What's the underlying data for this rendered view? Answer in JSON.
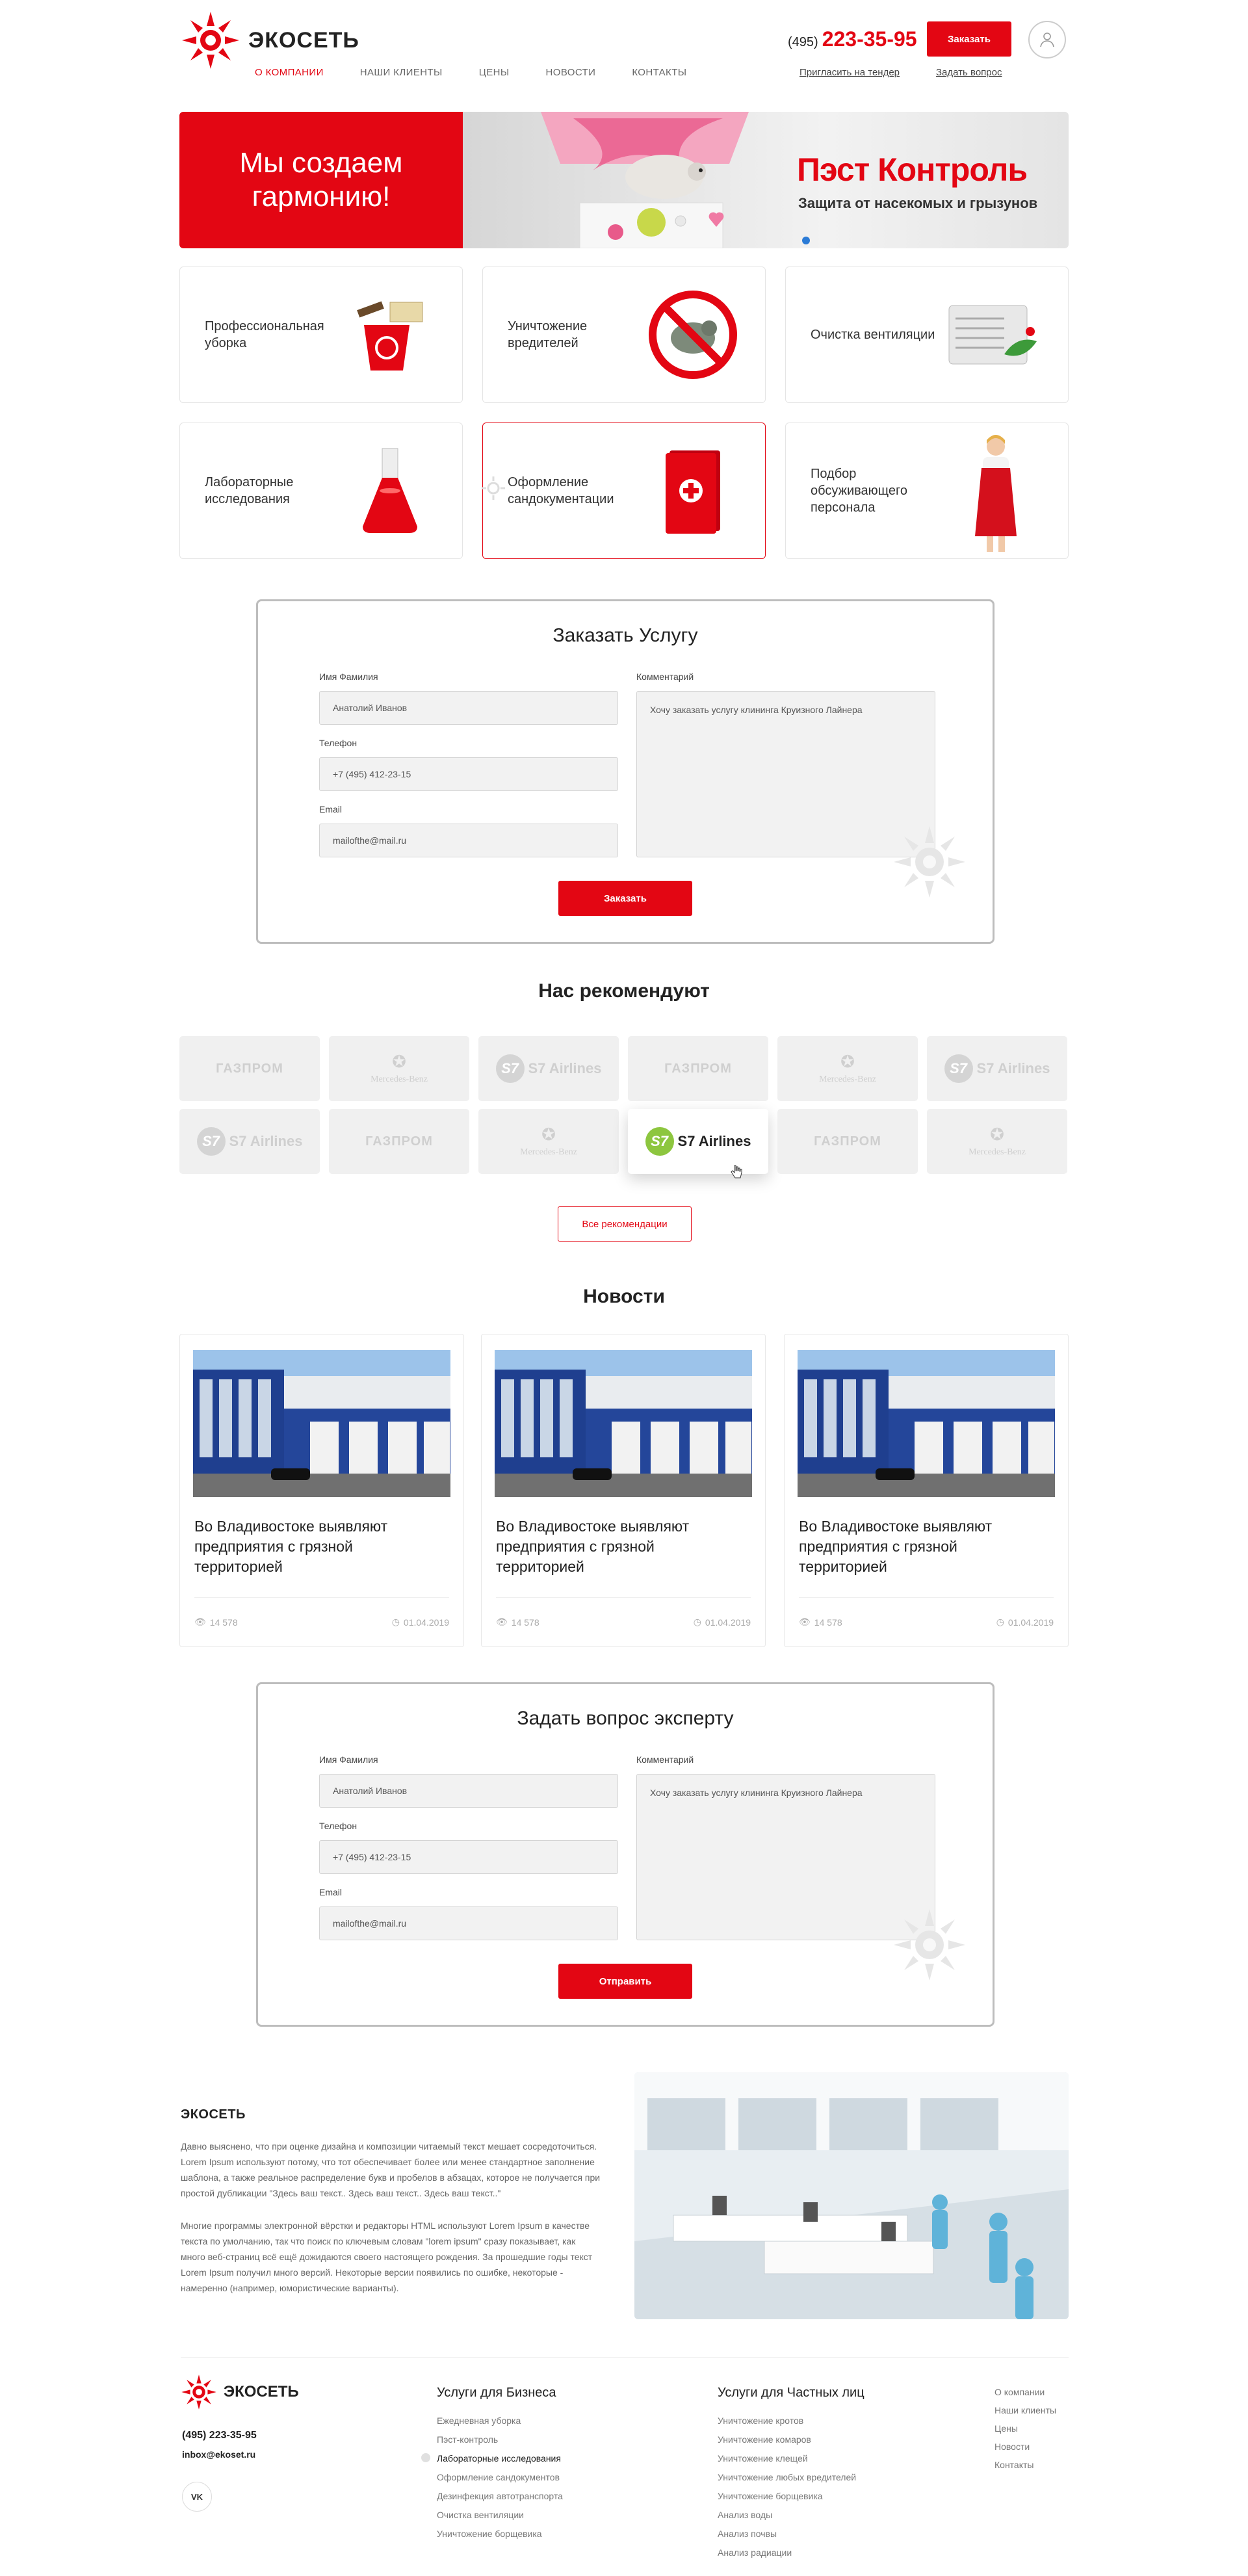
{
  "header": {
    "logo_text": "ЭКОСЕТЬ",
    "nav": [
      "О компании",
      "Наши клиенты",
      "Цены",
      "Новости",
      "Контакты"
    ],
    "phone_code": "(495)",
    "phone_number": "223-35-95",
    "order_button": "Заказать",
    "tender_link": "Пригласить на тендер",
    "question_link": "Задать вопрос"
  },
  "banner": {
    "left_text": "Мы создаем гармонию!",
    "title": "Пэст Контроль",
    "subtitle": "Защита от насекомых и грызунов"
  },
  "services": [
    {
      "label": "Профессиональная уборка",
      "icon": "cleaning-bucket-icon"
    },
    {
      "label": "Уничтожение вредителей",
      "icon": "no-rodent-icon"
    },
    {
      "label": "Очистка вентиляции",
      "icon": "air-conditioner-icon"
    },
    {
      "label": "Лабораторные исследования",
      "icon": "flask-icon"
    },
    {
      "label": "Оформление сандокументации",
      "icon": "red-book-icon"
    },
    {
      "label": "Подбор обсуживающего персонала",
      "icon": "staff-woman-icon"
    }
  ],
  "order_form": {
    "title": "Заказать Услугу",
    "name_label": "Имя Фамилия",
    "name_value": "Анатолий Иванов",
    "phone_label": "Телефон",
    "phone_value": "+7 (495) 412-23-15",
    "email_label": "Email",
    "email_value": "mailofthe@mail.ru",
    "comment_label": "Комментарий",
    "comment_value": "Хочу заказать услугу клининга Круизного Лайнера",
    "submit": "Заказать"
  },
  "partners": {
    "title": "Нас рекомендуют",
    "rows": [
      [
        "ГАЗПРОМ",
        "Mercedes-Benz",
        "S7 Airlines",
        "ГАЗПРОМ",
        "Mercedes-Benz",
        "S7 Airlines"
      ],
      [
        "S7 Airlines",
        "ГАЗПРОМ",
        "Mercedes-Benz",
        "S7 Airlines",
        "ГАЗПРОМ",
        "Mercedes-Benz"
      ]
    ],
    "all_button": "Все рекомендации"
  },
  "news": {
    "title": "Новости",
    "items": [
      {
        "title": "Во Владивостоке выявляют предприятия с грязной территорией",
        "views": "14 578",
        "date": "01.04.2019"
      },
      {
        "title": "Во Владивостоке выявляют предприятия с грязной территорией",
        "views": "14 578",
        "date": "01.04.2019"
      },
      {
        "title": "Во Владивостоке выявляют предприятия с грязной территорией",
        "views": "14 578",
        "date": "01.04.2019"
      }
    ]
  },
  "expert_form": {
    "title": "Задать вопрос эксперту",
    "name_label": "Имя Фамилия",
    "name_value": "Анатолий Иванов",
    "phone_label": "Телефон",
    "phone_value": "+7 (495) 412-23-15",
    "email_label": "Email",
    "email_value": "mailofthe@mail.ru",
    "comment_label": "Комментарий",
    "comment_value": "Хочу заказать услугу клининга Круизного Лайнера",
    "submit": "Отправить"
  },
  "about": {
    "title": "ЭКОСЕТЬ",
    "p1": "Давно выяснено, что при оценке дизайна и композиции читаемый текст мешает сосредоточиться. Lorem Ipsum используют потому, что тот обеспечивает более или менее стандартное заполнение шаблона, а также реальное распределение букв и пробелов в абзацах, которое не получается при простой дубликации \"Здесь ваш текст.. Здесь ваш текст.. Здесь ваш текст..\"",
    "p2": "Многие программы электронной вёрстки и редакторы HTML используют Lorem Ipsum в качестве текста по умолчанию, так что поиск по ключевым словам \"lorem ipsum\" сразу показывает, как много веб-страниц всё ещё дожидаются своего настоящего рождения. За прошедшие годы текст Lorem Ipsum получил много версий. Некоторые версии появились по ошибке, некоторые - намеренно (например, юмористические варианты)."
  },
  "footer": {
    "logo_text": "ЭКОСЕТЬ",
    "phone": "(495) 223-35-95",
    "email": "inbox@ekoset.ru",
    "social": "VK",
    "business_title": "Услуги для Бизнеса",
    "business_links": [
      "Ежедневная уборка",
      "Пэст-контроль",
      "Лабораторные исследования",
      "Оформление сандокументов",
      "Дезинфекция автотранспорта",
      "Очистка вентиляции",
      "Уничтожение борщевика"
    ],
    "private_title": "Услуги для Частных лиц",
    "private_links": [
      "Уничтожение кротов",
      "Уничтожение комаров",
      "Уничтожение клещей",
      "Уничтожение любых вредителей",
      "Уничтожение борщевика",
      "Анализ воды",
      "Анализ почвы",
      "Анализ радиации"
    ],
    "menu_links": [
      "О компании",
      "Наши клиенты",
      "Цены",
      "Новости",
      "Контакты"
    ]
  },
  "colors": {
    "accent": "#e30613",
    "s7_green": "#8dc63f"
  }
}
